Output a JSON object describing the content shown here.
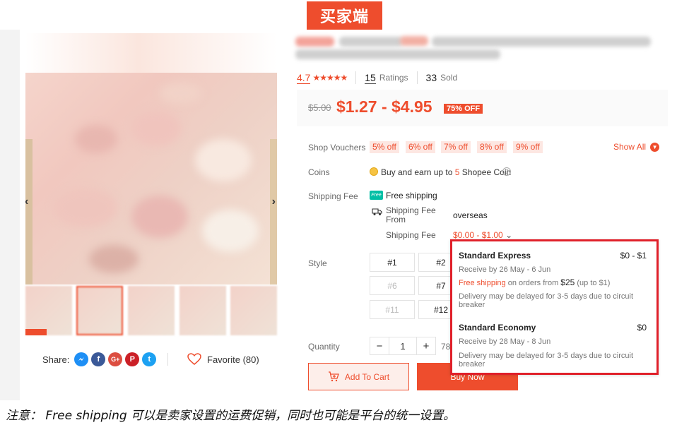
{
  "banner": "买家端",
  "share": {
    "label": "Share:",
    "icons": [
      {
        "name": "messenger-icon",
        "glyph": "~",
        "color": "#1e8ff5"
      },
      {
        "name": "facebook-icon",
        "glyph": "f",
        "color": "#3b5998"
      },
      {
        "name": "google-plus-icon",
        "glyph": "G+",
        "color": "#dc4e41"
      },
      {
        "name": "pinterest-icon",
        "glyph": "P",
        "color": "#cb2027"
      },
      {
        "name": "twitter-icon",
        "glyph": "t",
        "color": "#1da1f2"
      }
    ]
  },
  "favorite": {
    "label": "Favorite (80)"
  },
  "rating": {
    "score": "4.7",
    "stars": "★★★★★",
    "ratings_count": "15",
    "ratings_label": "Ratings",
    "sold_count": "33",
    "sold_label": "Sold"
  },
  "price": {
    "original": "$5.00",
    "range": "$1.27 - $4.95",
    "discount": "75% OFF"
  },
  "vouchers": {
    "label": "Shop Vouchers",
    "items": [
      "5% off",
      "6% off",
      "7% off",
      "8% off",
      "9% off"
    ],
    "show_all": "Show All"
  },
  "coins": {
    "label": "Coins",
    "text_before": "Buy and earn up to ",
    "amount": "5",
    "text_after": " Shopee Coin"
  },
  "shipping": {
    "label": "Shipping Fee",
    "free": "Free shipping",
    "free_badge": "Free",
    "from_label": "Shipping Fee From",
    "from_value": "overseas",
    "fee_label": "Shipping Fee",
    "fee_value": "$0.00 - $1.00"
  },
  "style": {
    "label": "Style",
    "options": [
      "#1",
      "#2",
      "#6",
      "#7",
      "#11",
      "#12"
    ]
  },
  "quantity": {
    "label": "Quantity",
    "minus": "−",
    "value": "1",
    "plus": "+",
    "available": "78"
  },
  "actions": {
    "add_to_cart": "Add To Cart",
    "buy_now": "Buy Now"
  },
  "popup": {
    "express": {
      "name": "Standard Express",
      "price": "$0 - $1",
      "receive": "Receive by 26 May - 6 Jun",
      "free_label": "Free shipping",
      "free_mid": " on orders from ",
      "free_amount": "$25",
      "free_cap": " (up to $1)",
      "note": "Delivery may be delayed for 3-5 days due to circuit breaker"
    },
    "economy": {
      "name": "Standard Economy",
      "price": "$0",
      "receive": "Receive by 28 May - 8 Jun",
      "note": "Delivery may be delayed for 3-5 days due to circuit breaker"
    }
  },
  "footnote": "注意： Free shipping 可以是卖家设置的运费促销，同时也可能是平台的统一设置。",
  "colors": {
    "accent": "#ee4d2d",
    "highlight_border": "#e0202a",
    "free_badge": "#00bfa5"
  }
}
